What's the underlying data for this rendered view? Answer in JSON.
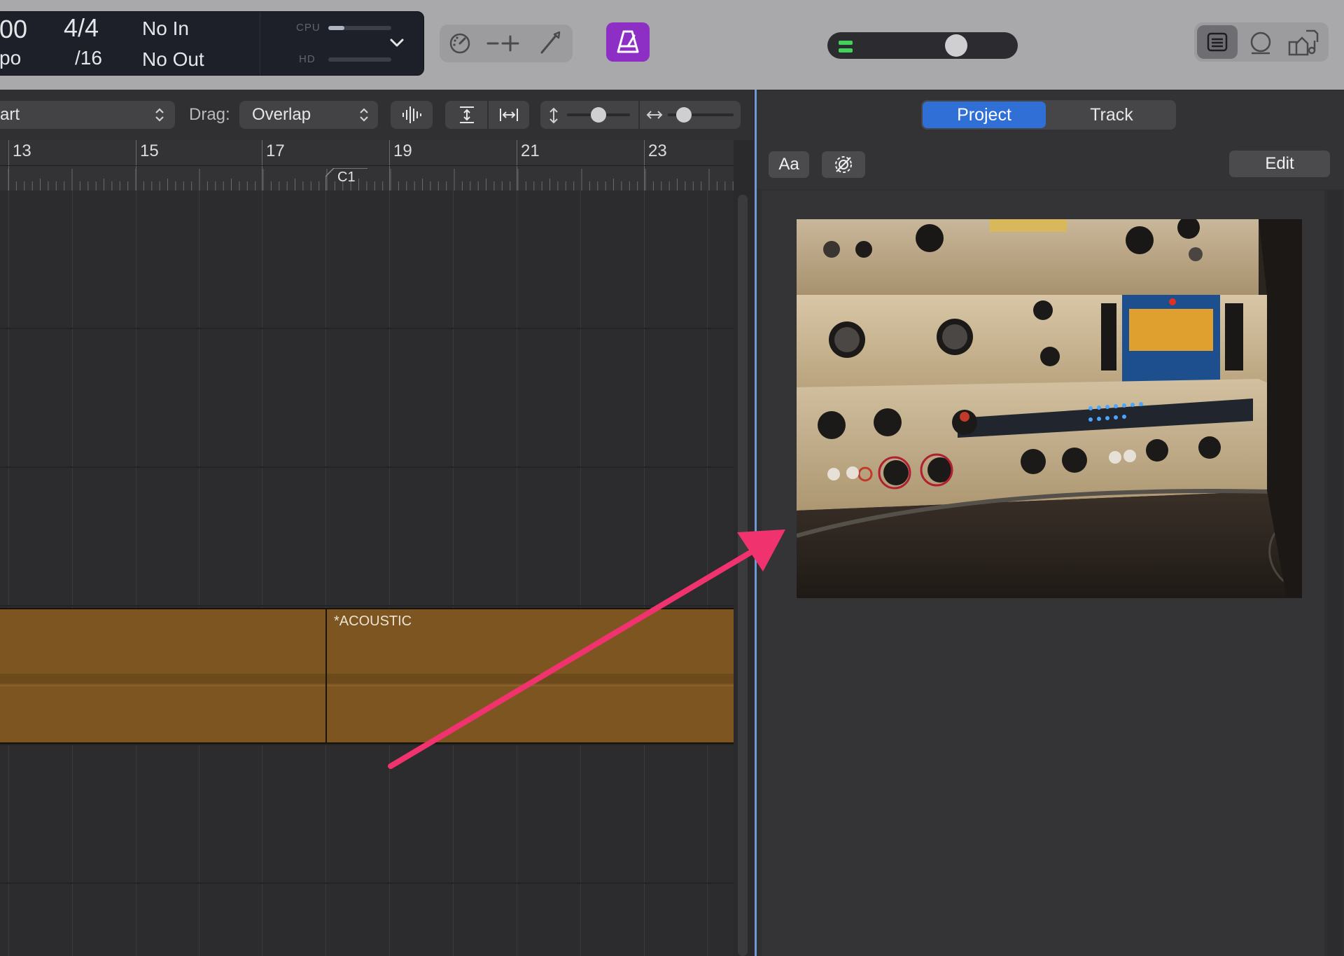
{
  "lcd": {
    "tempo_value": "00",
    "tempo_label": "po",
    "signature": "4/4",
    "division": "/16",
    "midi_in": "No In",
    "midi_out": "No Out",
    "cpu_label": "CPU",
    "hd_label": "HD",
    "cpu_level": 0.25,
    "hd_level": 0.0
  },
  "editor_toolbar": {
    "edit_mode_value": "art",
    "drag_label": "Drag:",
    "drag_value": "Overlap"
  },
  "ruler": {
    "bars": [
      "13",
      "15",
      "17",
      "19",
      "21",
      "23"
    ],
    "marker_label": "C1"
  },
  "region": {
    "name": "*ACOUSTIC"
  },
  "panel": {
    "tabs": [
      {
        "label": "Project",
        "selected": true
      },
      {
        "label": "Track",
        "selected": false
      }
    ],
    "font_button": "Aa",
    "edit_button": "Edit"
  },
  "colors": {
    "accent_blue": "#2f6fd6",
    "metronome_purple": "#8d2fc4",
    "region_orange": "#7d5520",
    "annotation_arrow": "#f0336e",
    "master_led_green": "#42d35a"
  },
  "icons": [
    "chevron-down-icon",
    "tuner-icon",
    "replace-icon",
    "brush-icon",
    "metronome-icon",
    "notes-icon",
    "loops-icon",
    "browser-icon",
    "waveform-icon",
    "vertical-zoom-icon",
    "horizontal-zoom-icon",
    "settings-gear-icon"
  ]
}
